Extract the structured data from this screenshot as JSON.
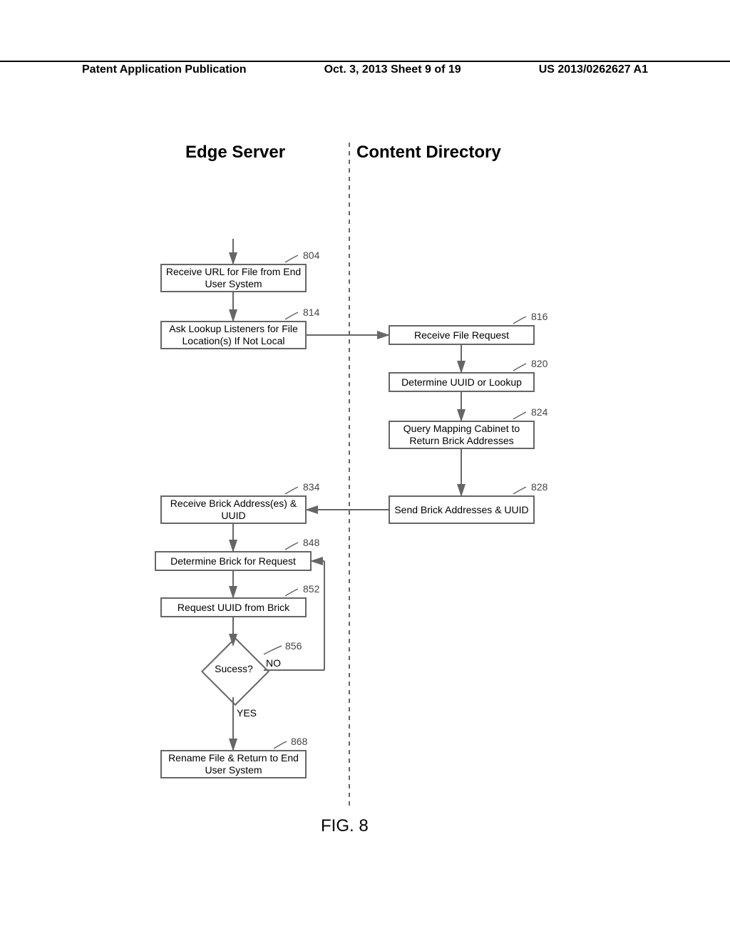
{
  "header": {
    "left": "Patent Application Publication",
    "middle": "Oct. 3, 2013  Sheet 9 of 19",
    "right": "US 2013/0262627 A1"
  },
  "titles": {
    "edge": "Edge Server",
    "content": "Content Directory"
  },
  "figure_label": "FIG. 8",
  "boxes": {
    "b804": "Receive URL for File from End User System",
    "b814": "Ask Lookup Listeners for File Location(s) If Not Local",
    "b816": "Receive File Request",
    "b820": "Determine UUID or Lookup",
    "b824": "Query Mapping Cabinet to Return Brick Addresses",
    "b828": "Send Brick Addresses & UUID",
    "b834": "Receive Brick Address(es) & UUID",
    "b848": "Determine Brick for Request",
    "b852": "Request UUID from Brick",
    "b856": "Sucess?",
    "b868": "Rename File & Return to End User System"
  },
  "refs": {
    "r804": "804",
    "r814": "814",
    "r816": "816",
    "r820": "820",
    "r824": "824",
    "r828": "828",
    "r834": "834",
    "r848": "848",
    "r852": "852",
    "r856": "856",
    "r868": "868"
  },
  "labels": {
    "no": "NO",
    "yes": "YES"
  }
}
